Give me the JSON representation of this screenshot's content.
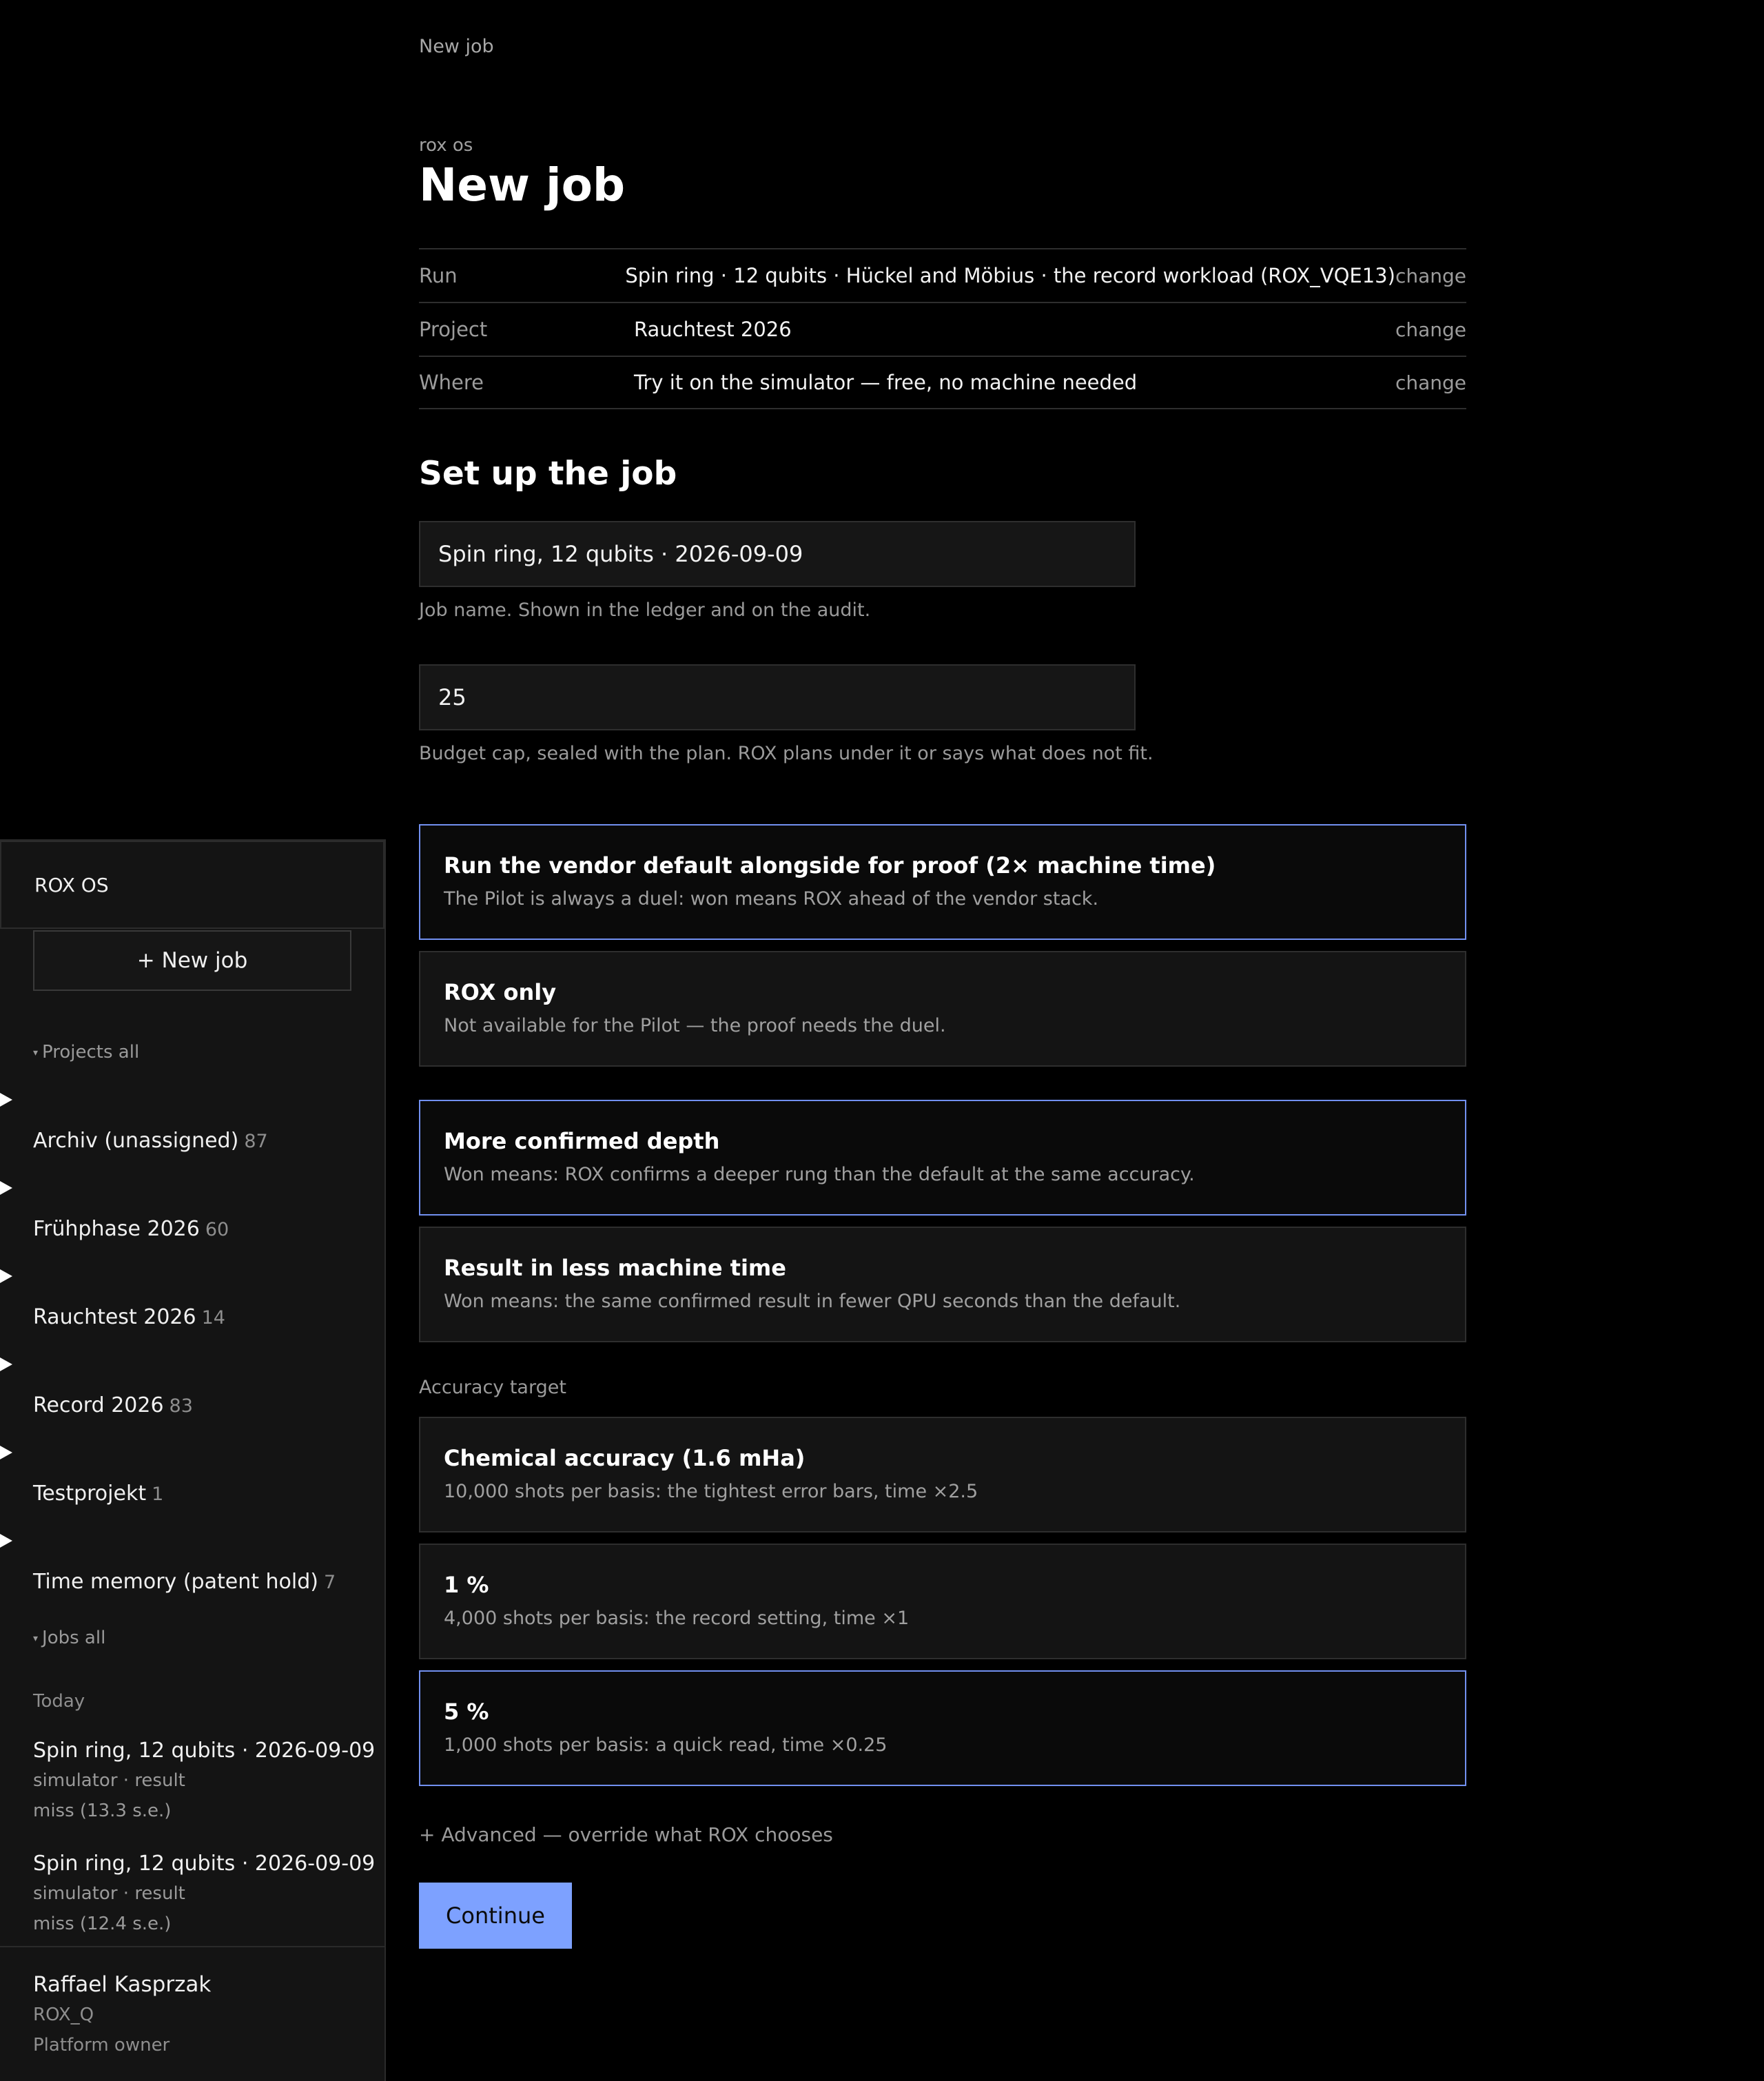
{
  "breadcrumb": "New job",
  "header": {
    "eyebrow": "rox os",
    "title": "New job"
  },
  "summary": [
    {
      "label": "Run",
      "value": "Spin ring · 12 qubits · Hückel and Möbius · the record workload (ROX_VQE13)",
      "action": "change"
    },
    {
      "label": "Project",
      "value": "Rauchtest 2026",
      "action": "change"
    },
    {
      "label": "Where",
      "value": "Try it on the simulator — free, no machine needed",
      "action": "change"
    }
  ],
  "setup": {
    "title": "Set up the job",
    "job_name": {
      "value": "Spin ring, 12 qubits · 2026-09-09",
      "hint": "Job name. Shown in the ledger and on the audit."
    },
    "budget": {
      "value": "25",
      "hint": "Budget cap, sealed with the plan. ROX plans under it or says what does not fit."
    }
  },
  "comparison_options": [
    {
      "title": "Run the vendor default alongside for proof (2× machine time)",
      "desc": "The Pilot is always a duel: won means ROX ahead of the vendor stack.",
      "selected": true
    },
    {
      "title": "ROX only",
      "desc": "Not available for the Pilot — the proof needs the duel.",
      "selected": false
    }
  ],
  "goal_options": [
    {
      "title": "More confirmed depth",
      "desc": "Won means: ROX confirms a deeper rung than the default at the same accuracy.",
      "selected": true
    },
    {
      "title": "Result in less machine time",
      "desc": "Won means: the same confirmed result in fewer QPU seconds than the default.",
      "selected": false
    }
  ],
  "accuracy": {
    "label": "Accuracy target",
    "options": [
      {
        "title": "Chemical accuracy (1.6 mHa)",
        "desc": "10,000 shots per basis: the tightest error bars, time ×2.5",
        "selected": false
      },
      {
        "title": "1 %",
        "desc": "4,000 shots per basis: the record setting, time ×1",
        "selected": false
      },
      {
        "title": "5 %",
        "desc": "1,000 shots per basis: a quick read, time ×0.25",
        "selected": true
      }
    ]
  },
  "advanced_link": "+ Advanced — override what ROX chooses",
  "continue_label": "Continue",
  "sidebar": {
    "brand": "ROX OS",
    "new_job": "+ New job",
    "projects_header": "Projects all",
    "projects": [
      {
        "name": "Archiv (unassigned)",
        "count": "87"
      },
      {
        "name": "Frühphase 2026",
        "count": "60"
      },
      {
        "name": "Rauchtest 2026",
        "count": "14"
      },
      {
        "name": "Record 2026",
        "count": "83"
      },
      {
        "name": "Testprojekt",
        "count": "1"
      },
      {
        "name": "Time memory (patent hold)",
        "count": "7"
      }
    ],
    "jobs_header": "Jobs all",
    "today": "Today",
    "jobs": [
      {
        "title": "Spin ring, 12 qubits · 2026-09-09",
        "meta": "simulator · result",
        "status": "miss (13.3 s.e.)"
      },
      {
        "title": "Spin ring, 12 qubits · 2026-09-09",
        "meta": "simulator · result",
        "status": "miss (12.4 s.e.)"
      }
    ],
    "user": {
      "name": "Raffael Kasprzak",
      "org": "ROX_Q",
      "role": "Platform owner"
    }
  },
  "colors": {
    "accent": "#7da1ff",
    "selected_border": "#7290f0",
    "panel": "#141414",
    "background": "#000000"
  }
}
